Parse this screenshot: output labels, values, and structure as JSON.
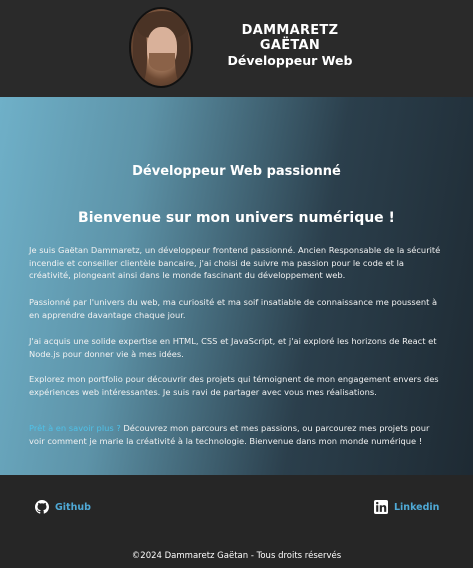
{
  "header": {
    "name": "DAMMARETZ GAËTAN",
    "role": "Développeur Web"
  },
  "main": {
    "hero_title": "Développeur Web passionné",
    "welcome": "Bienvenue sur mon univers numérique !",
    "paragraphs": [
      "Je suis Gaëtan Dammaretz, un développeur frontend passionné. Ancien Responsable de la sécurité incendie et conseiller clientèle bancaire, j'ai choisi de suivre ma passion pour le code et la créativité, plongeant ainsi dans le monde fascinant du développement web.",
      "Passionné par l'univers du web, ma curiosité et ma soif insatiable de connaissance me poussent à en apprendre davantage chaque jour.",
      "J'ai acquis une solide expertise en HTML, CSS et JavaScript, et j'ai exploré les horizons de React et Node.js pour donner vie à mes idées.",
      "Explorez mon portfolio pour découvrir des projets qui témoignent de mon engagement envers des expériences web intéressantes. Je suis ravi de partager avec vous mes réalisations."
    ],
    "cta_link": "Prêt à en savoir plus ?",
    "cta_text": " Découvrez mon parcours et mes passions, ou parcourez mes projets pour voir comment je marie la créativité à la technologie. Bienvenue dans mon monde numérique !"
  },
  "footer": {
    "github_label": "Github",
    "linkedin_label": "Linkedin",
    "copyright": "©2024 Dammaretz Gaëtan - Tous droits réservés"
  },
  "icons": {
    "github": "github-icon",
    "linkedin": "linkedin-icon"
  },
  "colors": {
    "accent_link": "#4fc1e8",
    "footer_link": "#4fa9d6",
    "header_bg": "#2a2a2a"
  }
}
